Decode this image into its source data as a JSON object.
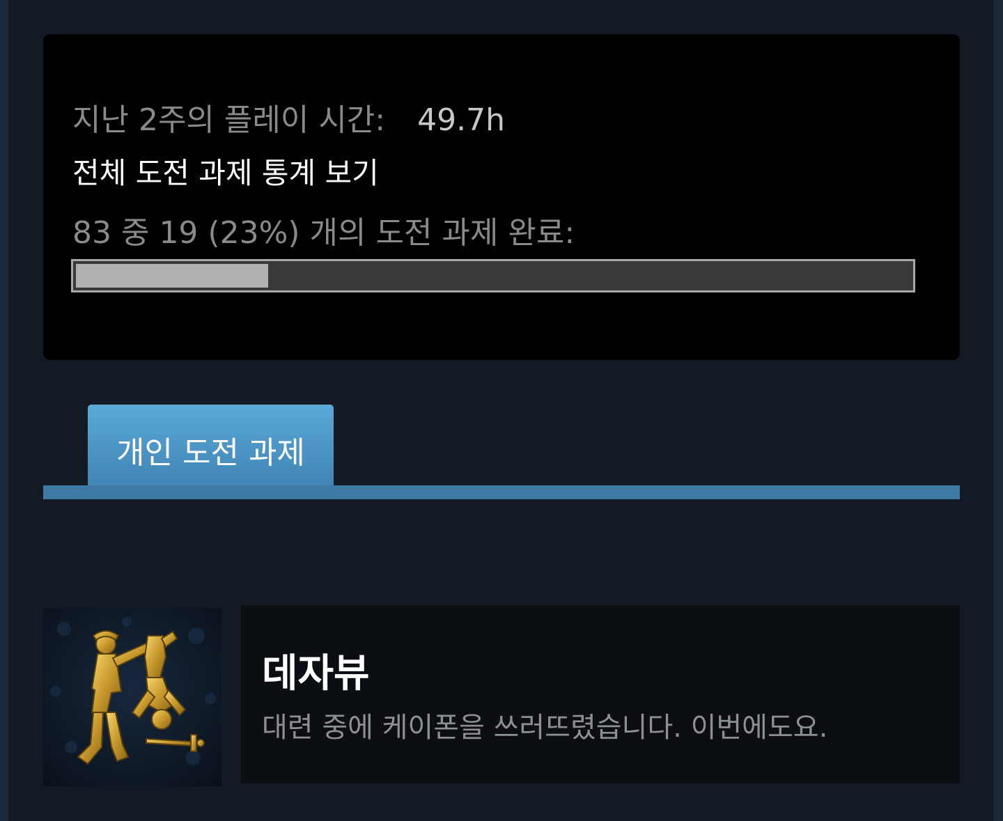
{
  "stats": {
    "playtime_label": "지난 2주의 플레이 시간:",
    "playtime_value": "49.7h",
    "global_stats_link": "전체 도전 과제 통계 보기",
    "progress_text": "83 중 19 (23%) 개의 도전 과제 완료:",
    "progress_percent": 23
  },
  "tabs": {
    "personal_label": "개인 도전 과제"
  },
  "achievement": {
    "icon": "fencing-duel-gold-icon",
    "title": "데자뷰",
    "description": "대련 중에 케이폰을 쓰러뜨렸습니다. 이번에도요."
  },
  "colors": {
    "page_background": "#141a23",
    "panel_background": "#000000",
    "tab_accent": "#5aa9d8",
    "tab_bar": "#3e7aa3",
    "progress_fill": "#b0b0b0",
    "progress_track": "#3a3a3a"
  }
}
